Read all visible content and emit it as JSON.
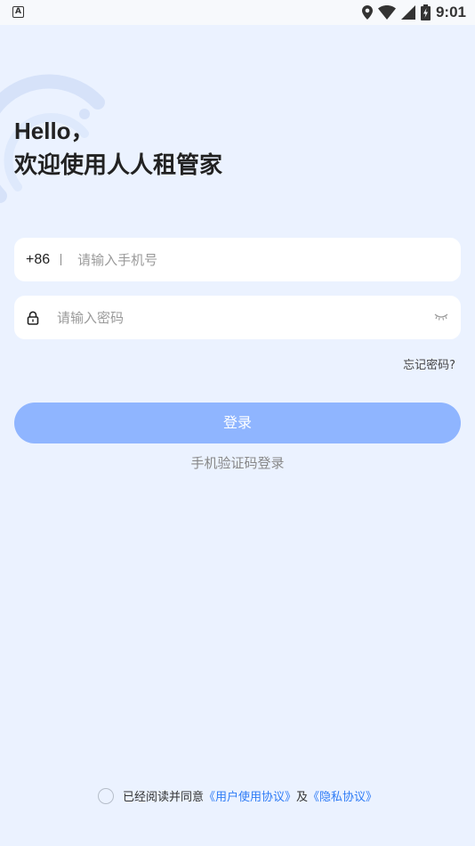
{
  "status_bar": {
    "app_icon_letter": "A",
    "time": "9:01",
    "icons": [
      "location-icon",
      "wifi-icon",
      "signal-icon",
      "battery-icon"
    ]
  },
  "greeting": {
    "line1": "Hello，",
    "line2": "欢迎使用人人租管家"
  },
  "phone_field": {
    "country_code": "+86",
    "placeholder": "请输入手机号",
    "value": ""
  },
  "password_field": {
    "placeholder": "请输入密码",
    "value": "",
    "lock_icon": "lock-icon",
    "toggle_icon": "eye-closed-icon"
  },
  "forgot_password": "忘记密码?",
  "login_button": "登录",
  "sms_login_link": "手机验证码登录",
  "agreement": {
    "checked": false,
    "prefix": "已经阅读并同意",
    "user_agreement": "《用户使用协议》",
    "conjunction": "及",
    "privacy_policy": "《隐私协议》"
  },
  "colors": {
    "background": "#ebf2ff",
    "primary_button": "#8fb5ff",
    "link": "#2f7cf6"
  }
}
